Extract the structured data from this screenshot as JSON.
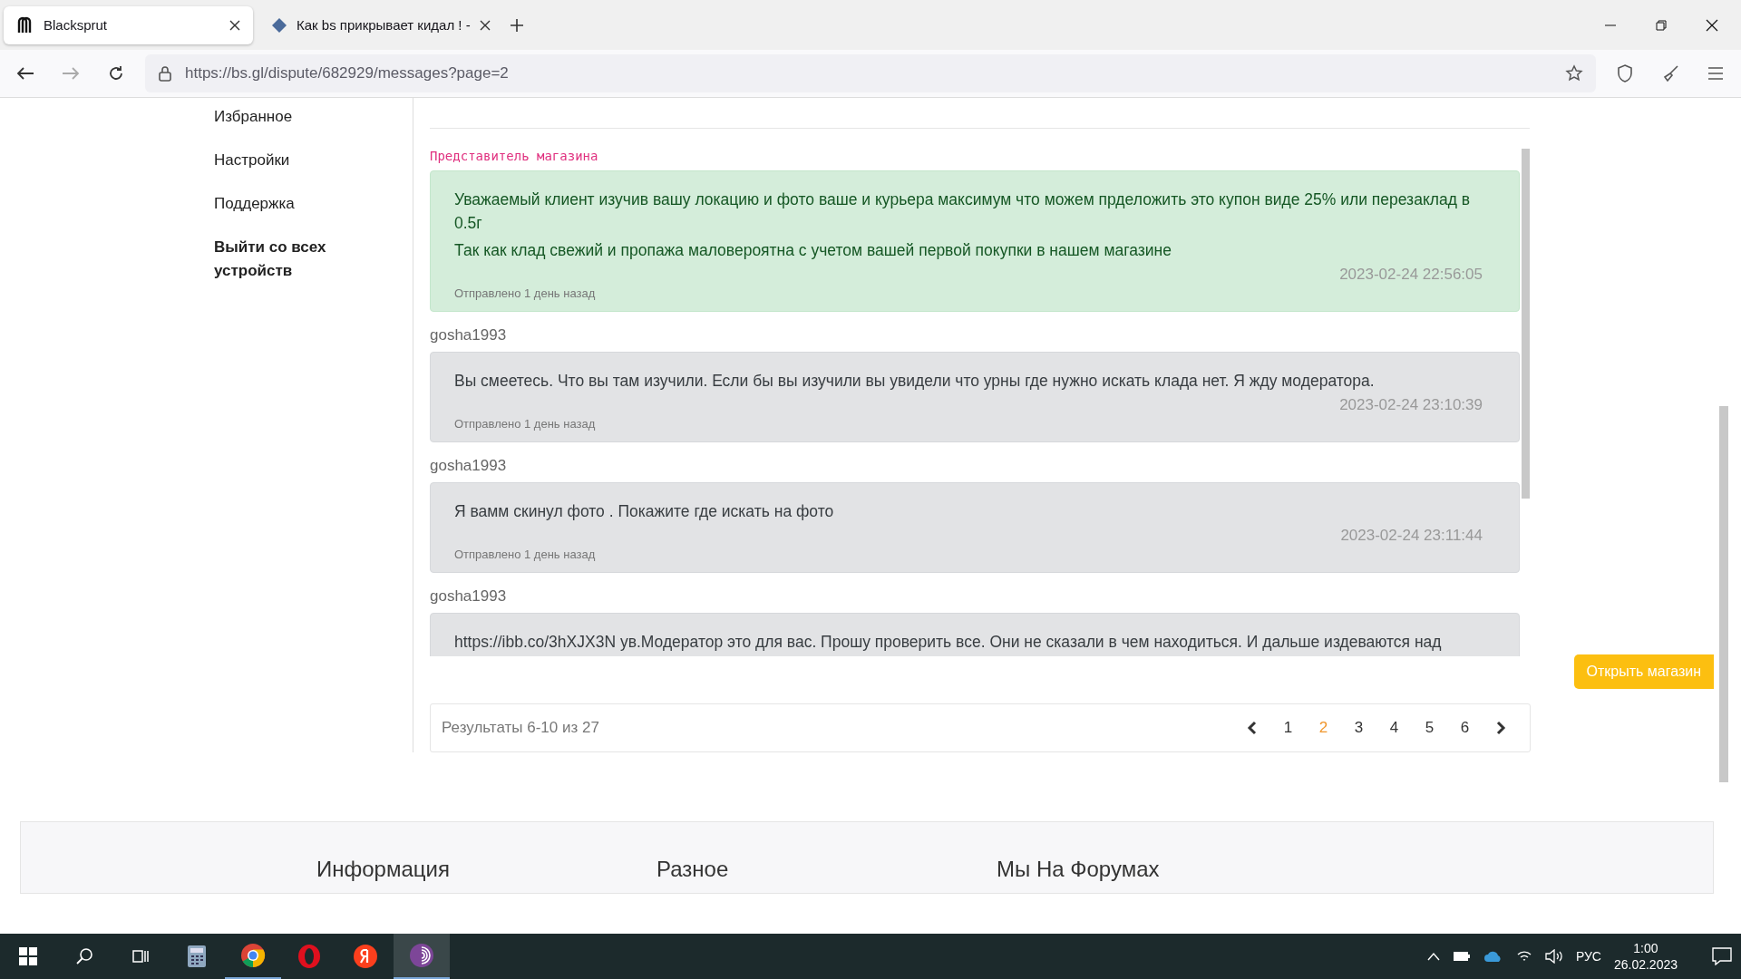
{
  "browser": {
    "tabs": [
      {
        "title": "Blacksprut",
        "selected": true
      },
      {
        "title": "Как bs прикрывает кидал ! -",
        "selected": false
      }
    ],
    "url": "https://bs.gl/dispute/682929/messages?page=2"
  },
  "sidebar": {
    "items": [
      {
        "label": "Избранное",
        "bold": false
      },
      {
        "label": "Настройки",
        "bold": false
      },
      {
        "label": "Поддержка",
        "bold": false
      },
      {
        "label": "Выйти со всех устройств",
        "bold": true
      }
    ]
  },
  "messages": [
    {
      "kind": "shop",
      "author": "Представитель магазина",
      "paragraphs": [
        "Уважаемый клиент изучив вашу локацию и фото ваше и курьера максимум что можем прделожить это купон виде 25% или перезаклад в 0.5г",
        "Так как клад свежий и пропажа маловероятна с учетом вашей первой покупки в нашем магазине"
      ],
      "sent": "Отправлено 1 день назад",
      "time": "2023-02-24 22:56:05"
    },
    {
      "kind": "user",
      "author": "gosha1993",
      "paragraphs": [
        "Вы смеетесь. Что вы там изучили. Если бы вы изучили вы увидели что урны где нужно искать клада нет. Я жду модератора."
      ],
      "sent": "Отправлено 1 день назад",
      "time": "2023-02-24 23:10:39"
    },
    {
      "kind": "user",
      "author": "gosha1993",
      "paragraphs": [
        "Я вамм скинул фото . Покажите где искать на фото"
      ],
      "sent": "Отправлено 1 день назад",
      "time": "2023-02-24 23:11:44"
    },
    {
      "kind": "user",
      "author": "gosha1993",
      "paragraphs": [
        "https://ibb.co/3hXJX3N ув.Модератор это для вас. Прошу проверить все. Они не сказали в чем находиться. И дальше издеваются над"
      ]
    }
  ],
  "pagination": {
    "summary": "Результаты 6-10 из 27",
    "pages": [
      {
        "label": "1",
        "selected": false
      },
      {
        "label": "2",
        "selected": true
      },
      {
        "label": "3",
        "selected": false
      },
      {
        "label": "4",
        "selected": false
      },
      {
        "label": "5",
        "selected": false
      },
      {
        "label": "6",
        "selected": false
      }
    ]
  },
  "open_shop_button": "Открыть магазин",
  "footer": {
    "headings": [
      "Информация",
      "Разное",
      "Мы На Форумах"
    ]
  },
  "taskbar": {
    "language": "РУС",
    "time": "1:00",
    "date": "26.02.2023"
  }
}
